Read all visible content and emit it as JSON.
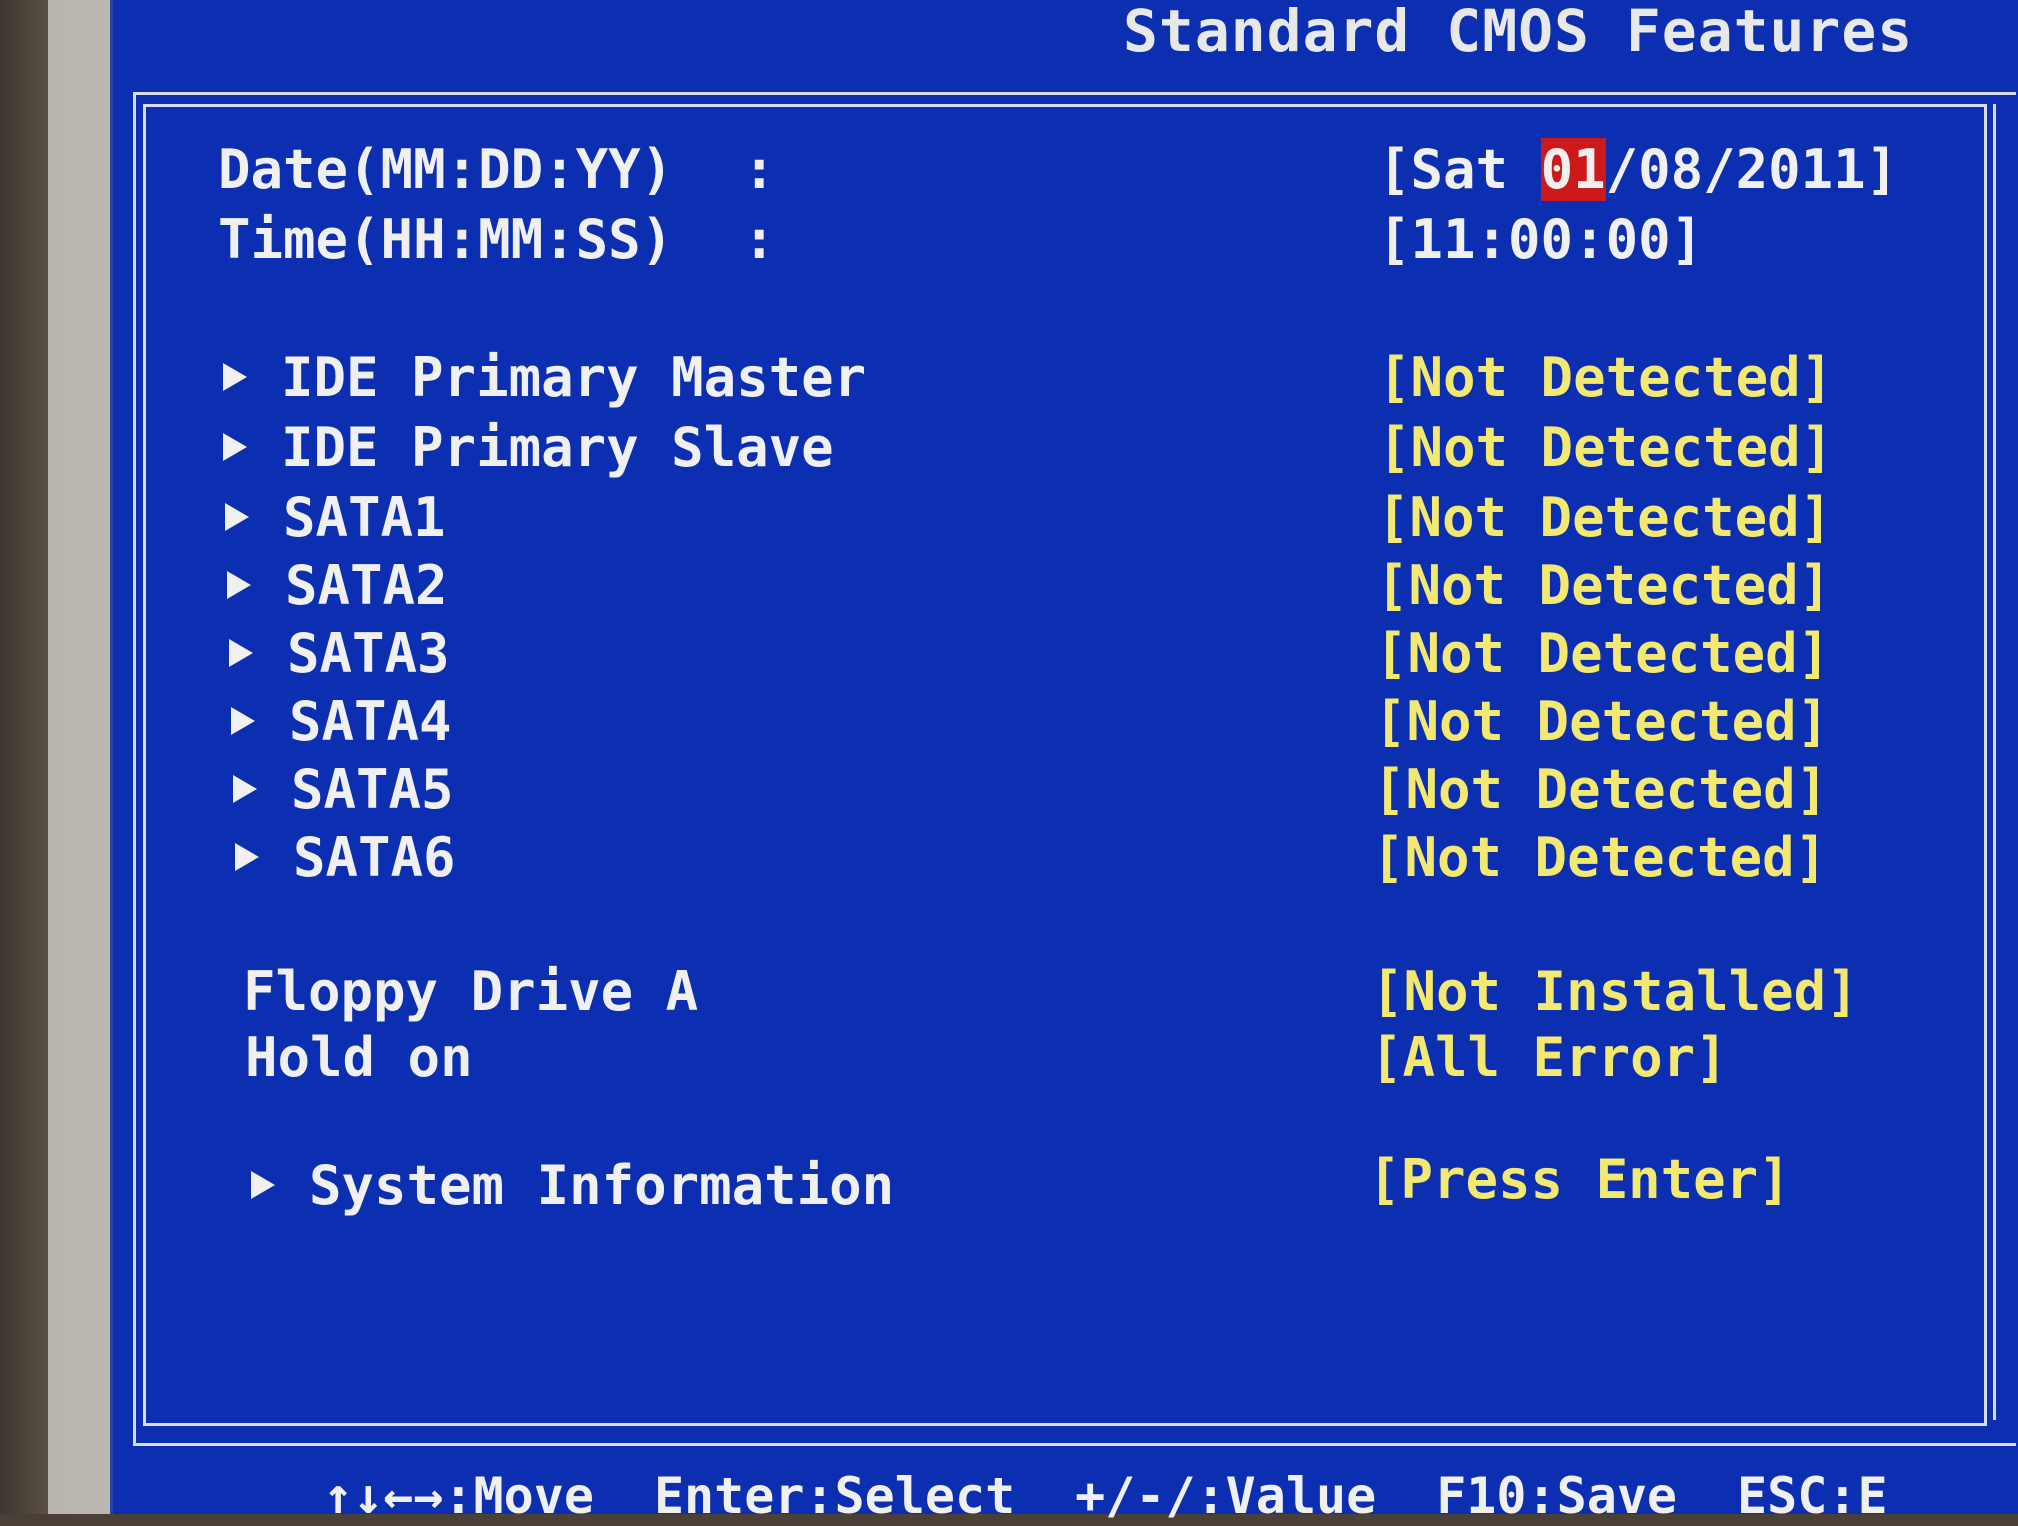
{
  "header": {
    "title": "Standard CMOS Features"
  },
  "date": {
    "label": "Date(MM:DD:YY)",
    "colon": ":",
    "open": "[Sat ",
    "selected": "01",
    "rest": "/08/2011]"
  },
  "time": {
    "label": "Time(HH:MM:SS)",
    "colon": ":",
    "value": "[11:00:00]"
  },
  "drives": [
    {
      "label": "IDE Primary Master",
      "value": "[Not Detected]"
    },
    {
      "label": "IDE Primary Slave",
      "value": "[Not Detected]"
    },
    {
      "label": "SATA1",
      "value": "[Not Detected]"
    },
    {
      "label": "SATA2",
      "value": "[Not Detected]"
    },
    {
      "label": "SATA3",
      "value": "[Not Detected]"
    },
    {
      "label": "SATA4",
      "value": "[Not Detected]"
    },
    {
      "label": "SATA5",
      "value": "[Not Detected]"
    },
    {
      "label": "SATA6",
      "value": "[Not Detected]"
    }
  ],
  "floppy": {
    "label": "Floppy Drive A",
    "value": "[Not Installed]"
  },
  "hold": {
    "label": "Hold on",
    "value": "[All Error]"
  },
  "sysinfo": {
    "label": "System Information",
    "value": "[Press Enter]"
  },
  "footer": {
    "move": "↑↓←→:Move",
    "select": "Enter:Select",
    "value": "+/-/:Value",
    "save": "F10:Save",
    "esc": "ESC:E"
  },
  "colors": {
    "background": "#0b2fb0",
    "label": "#f0f0f0",
    "value": "#f2e872",
    "highlight": "#cc1a1a"
  }
}
